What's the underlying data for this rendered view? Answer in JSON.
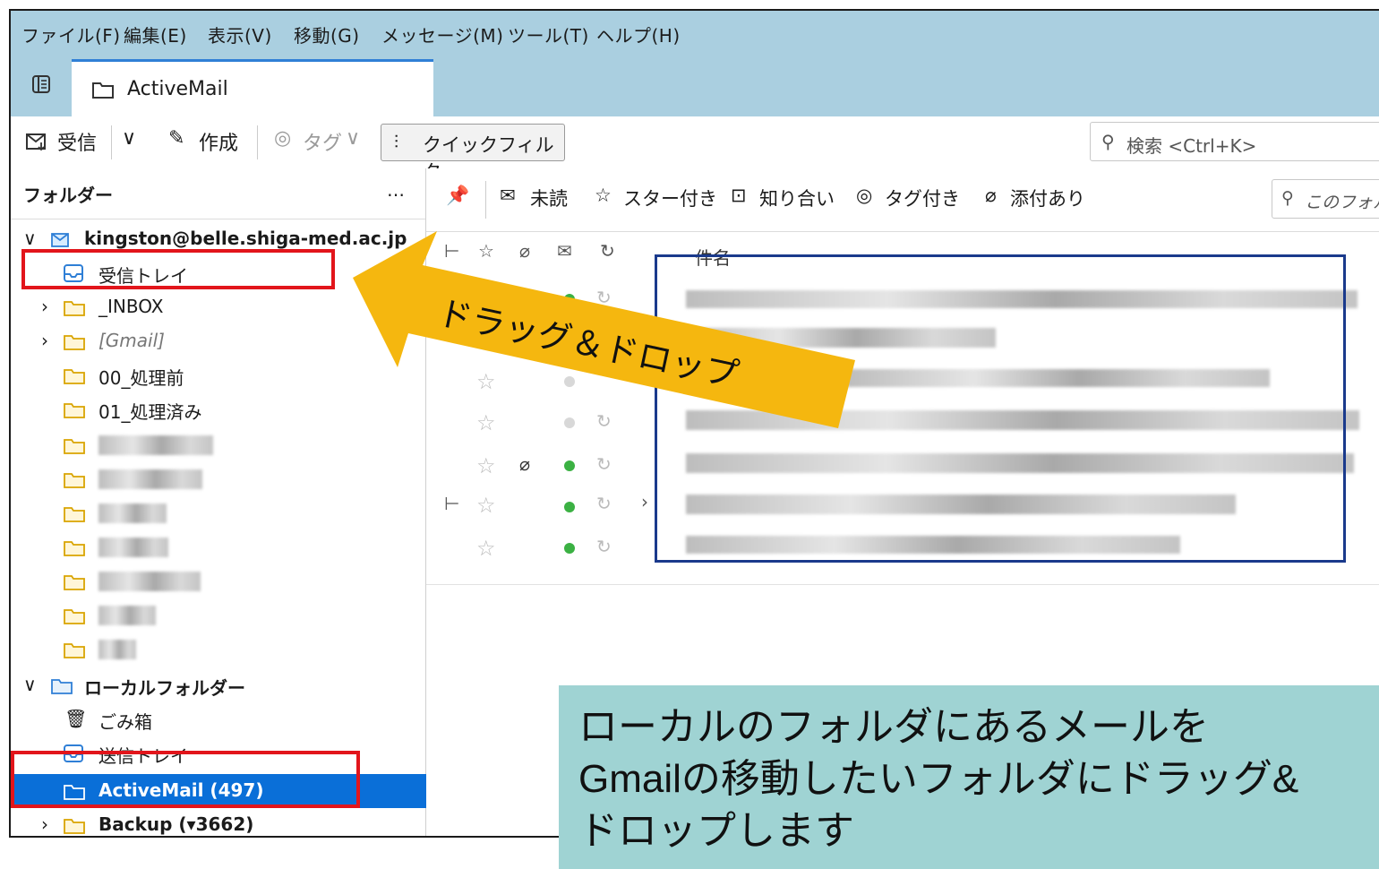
{
  "menu": [
    "ファイル(F)",
    "編集(E)",
    "表示(V)",
    "移動(G)",
    "メッセージ(M)",
    "ツール(T)",
    "ヘルプ(H)"
  ],
  "tab": {
    "label": "ActiveMail"
  },
  "toolbar": {
    "get_messages": "受信",
    "compose": "作成",
    "tag": "タグ",
    "quick_filter": "クイックフィルター",
    "search_placeholder": "検索 <Ctrl+K>"
  },
  "folder_pane": {
    "header": "フォルダー",
    "more": "…",
    "account": "kingston@belle.shiga-med.ac.jp",
    "folders": {
      "inbox": "受信トレイ",
      "inbox2": "_INBOX",
      "gmail": "[Gmail]",
      "f00": "00_処理前",
      "f01": "01_処理済み"
    },
    "local": "ローカルフォルダー",
    "trash": "ごみ箱",
    "sent": "送信トレイ",
    "activemail": "ActiveMail (497)",
    "backup": "Backup (▾3662)"
  },
  "quick_filter_bar": {
    "unread": "未読",
    "starred": "スター付き",
    "contacts": "知り合い",
    "tagged": "タグ付き",
    "attachment": "添付あり",
    "filter_placeholder": "このフォル"
  },
  "columns": {
    "subject": "件名"
  },
  "annotation": {
    "arrow_label": "ドラッグ＆ドロップ",
    "note_line1": "ローカルのフォルダにあるメールを",
    "note_line2": "Gmailの移動したいフォルダにドラッグ&",
    "note_line3": "ドロップします"
  },
  "colors": {
    "menubar": "#aacfe0",
    "selection": "#0a6fd8",
    "arrow": "#f5b70f",
    "highlight_red": "#e2151b",
    "highlight_blue": "#1a3a8c",
    "note_bg": "#9fd3d3"
  }
}
